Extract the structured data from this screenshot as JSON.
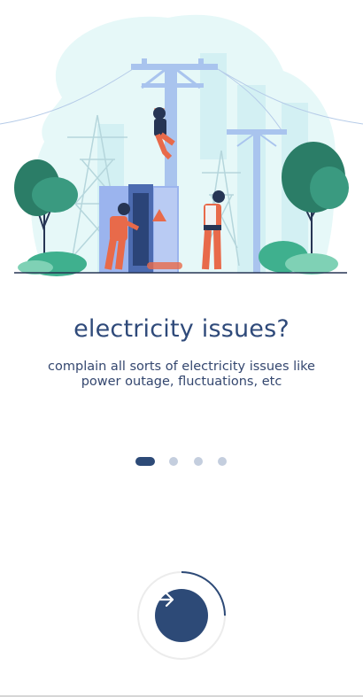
{
  "onboarding": {
    "title": "electricity issues?",
    "description": "complain all sorts of electricity issues like power outage, fluctuations, etc",
    "step_current": 1,
    "step_total": 4,
    "next_icon": "arrow-right-icon",
    "illustration": "electricians-repairing-power-lines"
  },
  "colors": {
    "primary": "#2d4a77",
    "dot_inactive": "#c4cede",
    "blob": "#e6f8f8",
    "tree": "#3a8c7a",
    "worker_suit": "#e86a4a"
  }
}
